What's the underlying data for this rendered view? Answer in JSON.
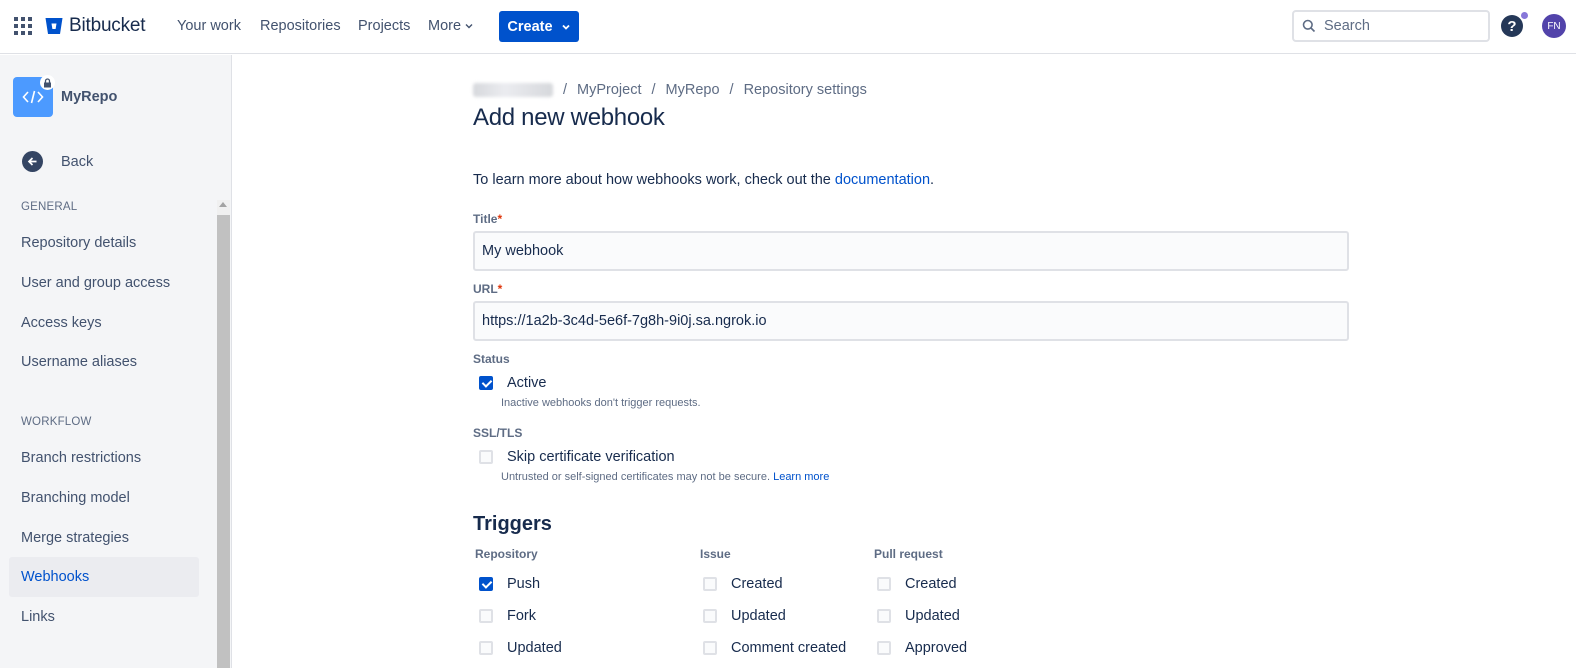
{
  "topbar": {
    "product": "Bitbucket",
    "nav": [
      "Your work",
      "Repositories",
      "Projects",
      "More"
    ],
    "create_label": "Create",
    "search_placeholder": "Search",
    "help_glyph": "?",
    "avatar_initials": "FN"
  },
  "sidebar": {
    "repo_name": "MyRepo",
    "back_label": "Back",
    "general_label": "GENERAL",
    "general_items": [
      "Repository details",
      "User and group access",
      "Access keys",
      "Username aliases"
    ],
    "workflow_label": "WORKFLOW",
    "workflow_items": [
      "Branch restrictions",
      "Branching model",
      "Merge strategies",
      "Webhooks",
      "Links"
    ],
    "active_item": "Webhooks"
  },
  "breadcrumb": [
    "MyProject",
    "MyRepo",
    "Repository settings"
  ],
  "page": {
    "title": "Add new webhook",
    "intro_prefix": "To learn more about how webhooks work, check out the ",
    "intro_link": "documentation",
    "intro_suffix": "."
  },
  "form": {
    "title_label": "Title",
    "title_value": "My webhook",
    "url_label": "URL",
    "url_value": "https://1a2b-3c4d-5e6f-7g8h-9i0j.sa.ngrok.io",
    "status_label": "Status",
    "active_label": "Active",
    "active_checked": true,
    "active_help": "Inactive webhooks don't trigger requests.",
    "ssl_label": "SSL/TLS",
    "skip_label": "Skip certificate verification",
    "skip_checked": false,
    "skip_help": "Untrusted or self-signed certificates may not be secure.",
    "skip_help_link": "Learn more",
    "required_mark": "*"
  },
  "triggers": {
    "title": "Triggers",
    "repository": {
      "heading": "Repository",
      "items": [
        "Push",
        "Fork",
        "Updated"
      ],
      "checked": [
        true,
        false,
        false
      ]
    },
    "issue": {
      "heading": "Issue",
      "items": [
        "Created",
        "Updated",
        "Comment created"
      ],
      "checked": [
        false,
        false,
        false
      ]
    },
    "pull_request": {
      "heading": "Pull request",
      "items": [
        "Created",
        "Updated",
        "Approved"
      ],
      "checked": [
        false,
        false,
        false
      ]
    }
  },
  "colors": {
    "accent": "#0052cc",
    "sidebar_bg": "#f4f5f7",
    "text": "#172b4d"
  }
}
